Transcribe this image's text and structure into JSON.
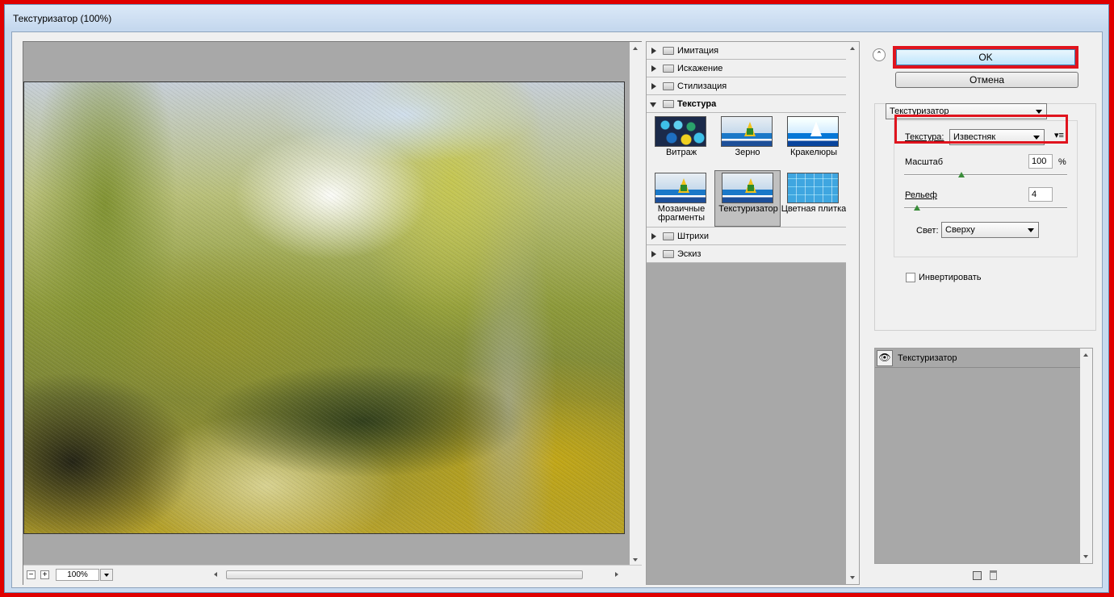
{
  "window": {
    "title": "Текстуризатор (100%)"
  },
  "preview": {
    "zoom": "100%",
    "zoom_out": "−",
    "zoom_in": "+"
  },
  "filter_gallery": {
    "categories_top": [
      {
        "label": "Имитация"
      },
      {
        "label": "Искажение"
      },
      {
        "label": "Стилизация"
      }
    ],
    "active_category": {
      "label": "Текстура"
    },
    "filters": [
      {
        "label": "Витраж"
      },
      {
        "label": "Зерно"
      },
      {
        "label": "Кракелюры"
      },
      {
        "label": "Мозаичные фрагменты"
      },
      {
        "label": "Текстуризатор",
        "selected": true
      },
      {
        "label": "Цветная плитка"
      }
    ],
    "categories_bottom": [
      {
        "label": "Штрихи"
      },
      {
        "label": "Эскиз"
      }
    ]
  },
  "buttons": {
    "ok": "OK",
    "cancel": "Отмена"
  },
  "settings": {
    "filter_select": "Текстуризатор",
    "texture_label": "Текстура:",
    "texture_value": "Известняк",
    "scale_label": "Масштаб",
    "scale_value": "100",
    "scale_unit": "%",
    "scale_level": 0.35,
    "relief_label": "Рельеф",
    "relief_value": "4",
    "relief_level": 0.08,
    "light_label": "Свет:",
    "light_value": "Сверху",
    "invert_label": "Инвертировать",
    "invert_checked": false
  },
  "layers": [
    {
      "name": "Текстуризатор",
      "visible": true
    }
  ],
  "colors": {
    "highlight": "#e0141e",
    "ok_button": "#bee6fd"
  }
}
